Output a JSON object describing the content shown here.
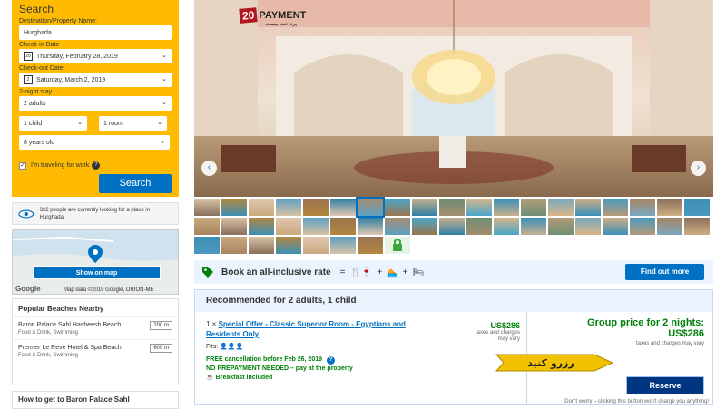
{
  "search": {
    "title": "Search",
    "dest_label": "Destination/Property Name:",
    "dest_value": "Hurghada",
    "checkin_label": "Check-in Date",
    "checkin_value": "Thursday, February 28, 2019",
    "checkout_label": "Check-out Date",
    "checkout_value": "Saturday, March 2, 2019",
    "stay_label": "2-night stay",
    "adults_value": "2 adults",
    "children_value": "1 child",
    "rooms_value": "1 room",
    "age_value": "8 years old",
    "work_label": "I'm traveling for work",
    "button": "Search"
  },
  "looking": {
    "text": "322 people are currently looking for a place in Hurghada"
  },
  "map": {
    "button": "Show on map",
    "brand": "Google",
    "footer": "Map data ©2019 Google, ORION-ME"
  },
  "beaches": {
    "title": "Popular Beaches Nearby",
    "items": [
      {
        "name": "Baron Palace Sahl Hasheesh Beach",
        "category": "Food & Drink, Swimming",
        "distance": "200 m"
      },
      {
        "name": "Premier Le Reve Hotel & Spa Beach",
        "category": "Food & Drink, Swimming",
        "distance": "600 m"
      }
    ]
  },
  "howto": {
    "title": "How to get to Baron Palace Sahl"
  },
  "watermark": {
    "number": "20",
    "text": "PAYMENT",
    "sub": "پرداخت بیست"
  },
  "allinclusive": {
    "text": "Book an all-inclusive rate",
    "button": "Find out more"
  },
  "recommended": {
    "title": "Recommended for 2 adults, 1 child",
    "room_qty": "1 ×",
    "room_name": "Special Offer - Classic Superior Room - Egyptians and Residents Only",
    "fits_label": "Fits:",
    "price": "US$286",
    "price_note": "taxes and charges may vary",
    "cancellation": "FREE cancellation before Feb 26, 2019",
    "prepayment": "NO PREPAYMENT NEEDED – pay at the property",
    "breakfast": "Breakfast included",
    "group_title": "Group price for 2 nights:",
    "group_price": "US$286",
    "group_note": "taxes and charges may vary",
    "reserve_label_fa": "رزرو کنید",
    "reserve_button": "Reserve",
    "dont_worry": "Don't worry – clicking this button won't charge you anything!"
  },
  "colors": {
    "accent": "#0071c2",
    "search_bg": "#febb02",
    "green": "#008009",
    "dark_blue": "#003580"
  }
}
